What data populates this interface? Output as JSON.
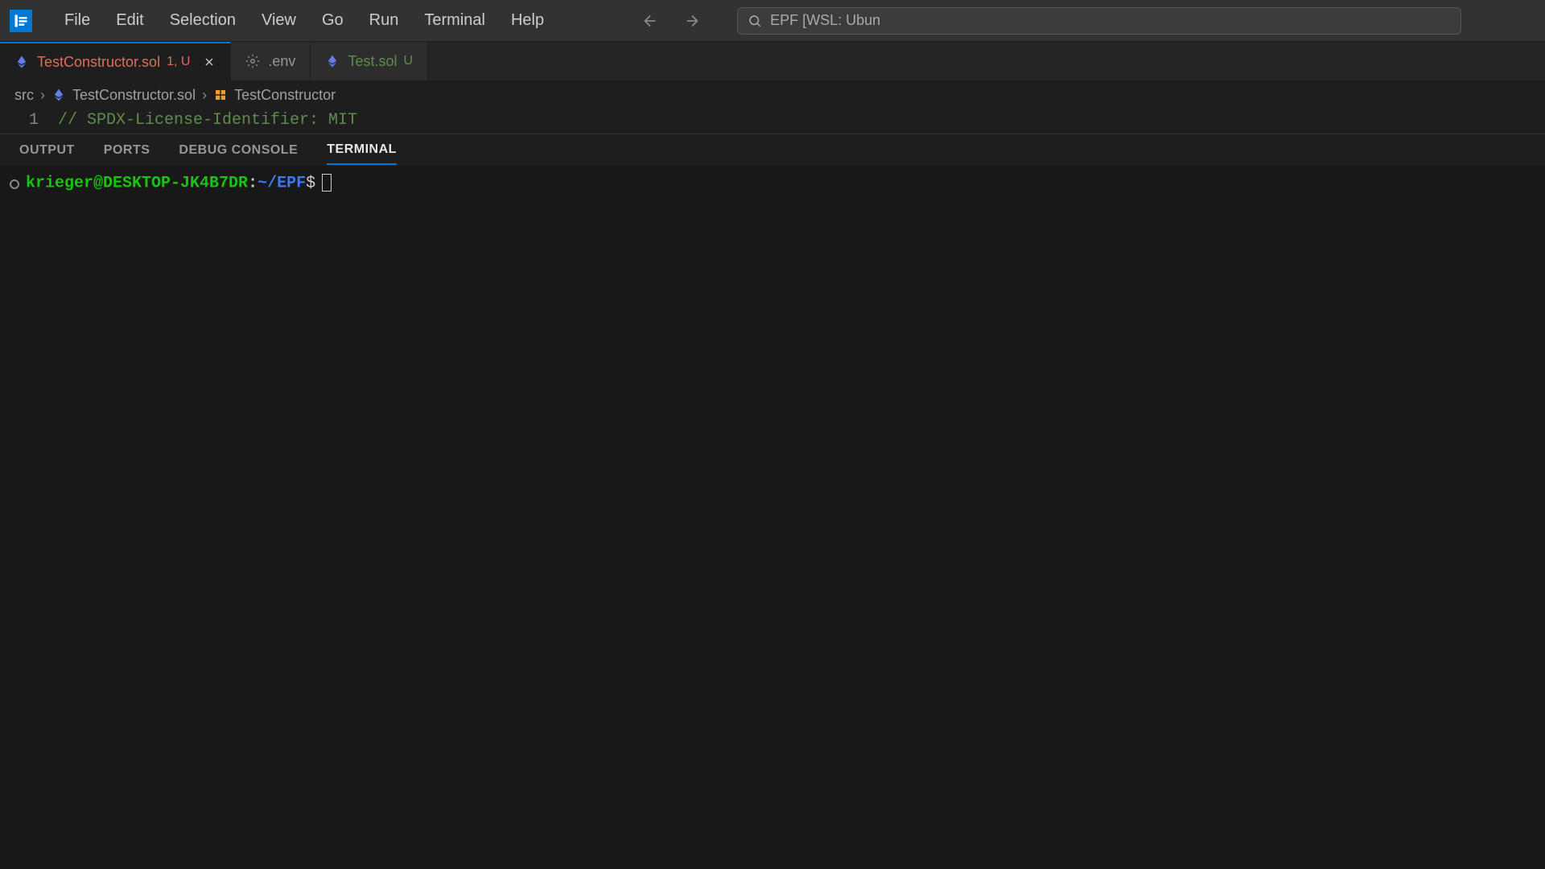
{
  "menubar": {
    "items": [
      "File",
      "Edit",
      "Selection",
      "View",
      "Go",
      "Run",
      "Terminal",
      "Help"
    ]
  },
  "search": {
    "text": "EPF [WSL: Ubun"
  },
  "tabs": [
    {
      "name": "TestConstructor.sol",
      "status": "1, U",
      "icon": "eth",
      "active": true,
      "modified": true
    },
    {
      "name": ".env",
      "status": "",
      "icon": "gear",
      "active": false,
      "modified": false
    },
    {
      "name": "Test.sol",
      "status": "U",
      "icon": "eth",
      "active": false,
      "modified": false
    }
  ],
  "breadcrumb": {
    "parts": [
      "src",
      "TestConstructor.sol",
      "TestConstructor"
    ]
  },
  "editor": {
    "line_number": "1",
    "line_text": "// SPDX-License-Identifier: MIT"
  },
  "panel": {
    "tabs": [
      "OUTPUT",
      "PORTS",
      "DEBUG CONSOLE",
      "TERMINAL"
    ],
    "active_index": 3
  },
  "terminal": {
    "user": "krieger",
    "host": "DESKTOP-JK4B7DR",
    "path": "~/EPF",
    "dollar": "$"
  }
}
